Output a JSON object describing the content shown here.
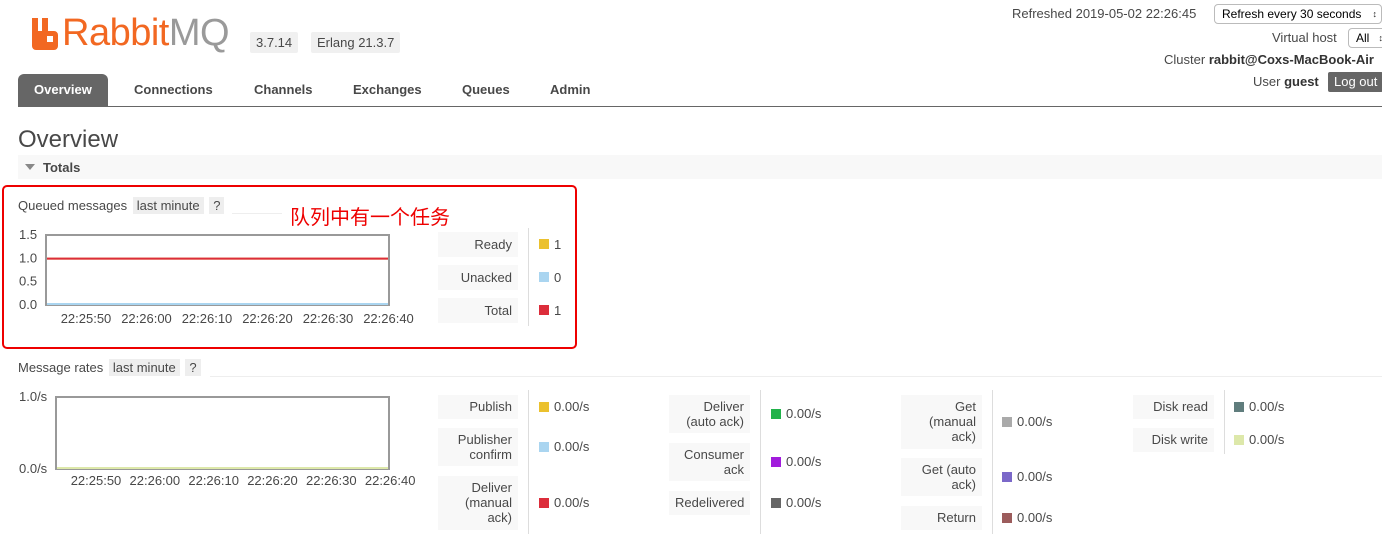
{
  "logo": {
    "rabbit": "Rabbit",
    "mq": "MQ",
    "tm": "TM"
  },
  "versions": {
    "rabbitmq": "3.7.14",
    "erlang": "Erlang 21.3.7"
  },
  "header": {
    "refreshed": "Refreshed 2019-05-02 22:26:45",
    "refresh_select": "Refresh every 30 seconds",
    "vhost_label": "Virtual host",
    "vhost_value": "All",
    "cluster_label": "Cluster",
    "cluster_value": "rabbit@Coxs-MacBook-Air",
    "user_label": "User",
    "user_value": "guest",
    "logout": "Log out"
  },
  "nav": {
    "tabs": [
      "Overview",
      "Connections",
      "Channels",
      "Exchanges",
      "Queues",
      "Admin"
    ],
    "active": "Overview"
  },
  "page_title": "Overview",
  "totals_label": "Totals",
  "annotation": "队列中有一个任务",
  "queued": {
    "label": "Queued messages",
    "range": "last minute",
    "help": "?",
    "legend": [
      {
        "label": "Ready",
        "value": "1",
        "color": "#ebc12e"
      },
      {
        "label": "Unacked",
        "value": "0",
        "color": "#aad5f0"
      },
      {
        "label": "Total",
        "value": "1",
        "color": "#dc2d3b"
      }
    ]
  },
  "rates": {
    "label": "Message rates",
    "range": "last minute",
    "help": "?",
    "legend_cols": [
      [
        {
          "label": "Publish",
          "value": "0.00/s",
          "color": "#ebc12e"
        },
        {
          "label": "Publisher confirm",
          "value": "0.00/s",
          "color": "#aad5f0"
        },
        {
          "label": "Deliver (manual ack)",
          "value": "0.00/s",
          "color": "#dc2d3b"
        }
      ],
      [
        {
          "label": "Deliver (auto ack)",
          "value": "0.00/s",
          "color": "#21b24a"
        },
        {
          "label": "Consumer ack",
          "value": "0.00/s",
          "color": "#a11cdc"
        },
        {
          "label": "Redelivered",
          "value": "0.00/s",
          "color": "#666666"
        }
      ],
      [
        {
          "label": "Get (manual ack)",
          "value": "0.00/s",
          "color": "#aaaaaa"
        },
        {
          "label": "Get (auto ack)",
          "value": "0.00/s",
          "color": "#7b68c9"
        },
        {
          "label": "Return",
          "value": "0.00/s",
          "color": "#9c5c5c"
        }
      ],
      [
        {
          "label": "Disk read",
          "value": "0.00/s",
          "color": "#607d7d"
        },
        {
          "label": "Disk write",
          "value": "0.00/s",
          "color": "#dde8aa"
        }
      ]
    ]
  },
  "chart_data": [
    {
      "type": "line",
      "x": [
        "22:25:50",
        "22:26:00",
        "22:26:10",
        "22:26:20",
        "22:26:30",
        "22:26:40"
      ],
      "ylim": [
        0,
        1.5
      ],
      "yticks": [
        "1.5",
        "1.0",
        "0.5",
        "0.0"
      ],
      "series": [
        {
          "name": "Ready",
          "values": [
            1,
            1,
            1,
            1,
            1,
            1
          ]
        },
        {
          "name": "Unacked",
          "values": [
            0,
            0,
            0,
            0,
            0,
            0
          ]
        },
        {
          "name": "Total",
          "values": [
            1,
            1,
            1,
            1,
            1,
            1
          ]
        }
      ]
    },
    {
      "type": "line",
      "x": [
        "22:25:50",
        "22:26:00",
        "22:26:10",
        "22:26:20",
        "22:26:30",
        "22:26:40"
      ],
      "ylim": [
        0,
        1
      ],
      "yticks": [
        "1.0/s",
        "0.0/s"
      ],
      "series": [
        {
          "name": "Publish",
          "values": [
            0,
            0,
            0,
            0,
            0,
            0
          ]
        },
        {
          "name": "Disk write",
          "values": [
            0,
            0,
            0,
            0,
            0,
            0
          ]
        }
      ]
    }
  ]
}
